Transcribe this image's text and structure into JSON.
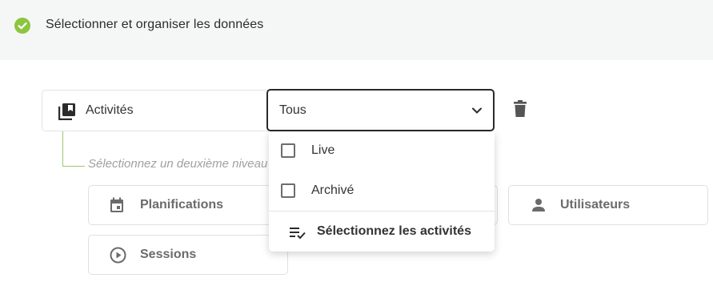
{
  "header": {
    "title": "Sélectionner et organiser les données",
    "status_icon": "check-circle-icon",
    "status_color": "#8cc63f"
  },
  "primary": {
    "label": "Activités",
    "icon": "library-books-icon"
  },
  "filter": {
    "value": "Tous",
    "icon": "chevron-down-icon"
  },
  "delete": {
    "icon": "trash-icon"
  },
  "secondary": {
    "hint": "Sélectionnez un deuxième niveau"
  },
  "tiles": [
    {
      "label": "Planifications",
      "icon": "calendar-icon"
    },
    {
      "label": "Utilisateurs",
      "icon": "person-icon"
    },
    {
      "label": "Sessions",
      "icon": "play-circle-icon"
    }
  ],
  "dropdown": {
    "options": [
      {
        "label": "Live",
        "checked": false
      },
      {
        "label": "Archivé",
        "checked": false
      }
    ],
    "select_all_label": "Sélectionnez les activités",
    "select_all_icon": "playlist-check-icon"
  }
}
